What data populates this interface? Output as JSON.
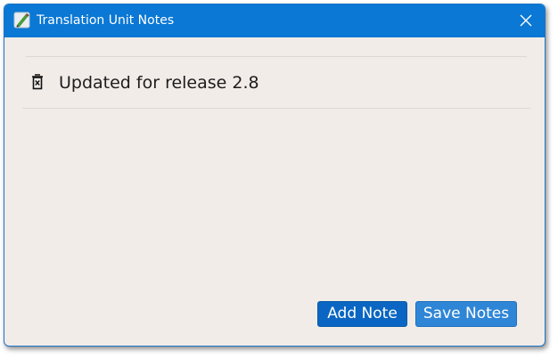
{
  "window": {
    "title": "Translation Unit Notes",
    "app_icon": "pen-paper-icon",
    "close_icon": "close-icon"
  },
  "notes": [
    {
      "text": "Updated for release 2.8",
      "delete_icon": "trash-icon"
    }
  ],
  "buttons": {
    "add_note_label": "Add Note",
    "save_notes_label": "Save Notes"
  },
  "colors": {
    "titlebar": "#0a78d4",
    "background": "#f2ece8",
    "primary_button": "#0a66c2",
    "secondary_button": "#2f86d6"
  }
}
